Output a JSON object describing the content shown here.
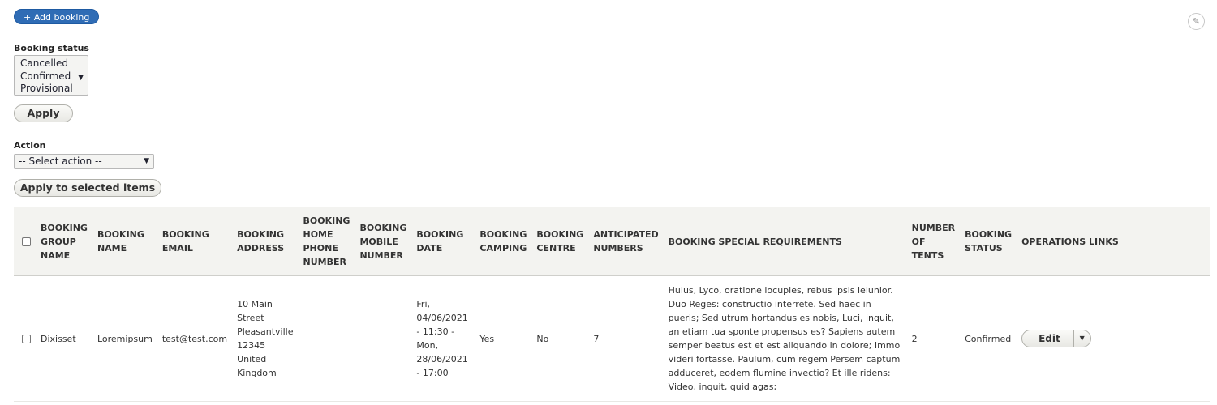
{
  "toolbar": {
    "add_booking_label": "+ Add booking",
    "edit_icon": "pencil-icon"
  },
  "filters": {
    "booking_status_label": "Booking status",
    "booking_status_options": [
      "Cancelled",
      "Confirmed",
      "Provisional"
    ],
    "apply_label": "Apply"
  },
  "bulk": {
    "action_label": "Action",
    "action_selected": "-- Select action --",
    "apply_selected_label": "Apply to selected items"
  },
  "table": {
    "headers": [
      "BOOKING GROUP NAME",
      "BOOKING NAME",
      "BOOKING EMAIL",
      "BOOKING ADDRESS",
      "BOOKING HOME PHONE NUMBER",
      "BOOKING MOBILE NUMBER",
      "BOOKING DATE",
      "BOOKING CAMPING",
      "BOOKING CENTRE",
      "ANTICIPATED NUMBERS",
      "BOOKING SPECIAL REQUIREMENTS",
      "NUMBER OF TENTS",
      "BOOKING STATUS",
      "OPERATIONS LINKS"
    ],
    "rows": [
      {
        "group_name": "Dixisset",
        "name": "Loremipsum",
        "email": "test@test.com",
        "address": "10 Main Street Pleasantville 12345 United Kingdom",
        "home_phone": "",
        "mobile": "",
        "date": "Fri, 04/06/2021 - 11:30 - Mon, 28/06/2021 - 17:00",
        "camping": "Yes",
        "centre": "No",
        "anticipated": "7",
        "special_requirements": "Huius, Lyco, oratione locuples, rebus ipsis ielunior. Duo Reges: constructio interrete. Sed haec in pueris; Sed utrum hortandus es nobis, Luci, inquit, an etiam tua sponte propensus es? Sapiens autem semper beatus est et est aliquando in dolore; Immo videri fortasse. Paulum, cum regem Persem captum adduceret, eodem flumine invectio? Et ille ridens: Video, inquit, quid agas;",
        "tents": "2",
        "status": "Confirmed",
        "operation_label": "Edit"
      }
    ]
  }
}
